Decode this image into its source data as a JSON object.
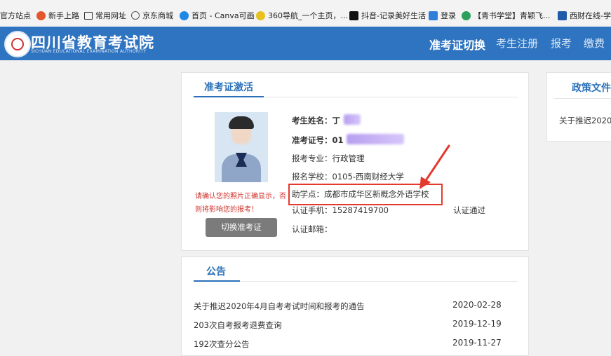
{
  "bookmarks": [
    {
      "label": "官方站点",
      "icon": "star-icon",
      "color": "#f2f2f2"
    },
    {
      "label": "新手上路",
      "icon": "firefox-icon",
      "color": "#e4572e"
    },
    {
      "label": "常用网址",
      "icon": "folder-icon",
      "color": "#f3f3f3"
    },
    {
      "label": "京东商城",
      "icon": "globe-icon",
      "color": "#555555"
    },
    {
      "label": "首页 - Canva可画",
      "icon": "canva-icon",
      "color": "#1e88e5"
    },
    {
      "label": "360导航_一个主页，...",
      "icon": "360-icon",
      "color": "#2e9a35"
    },
    {
      "label": "抖音-记录美好生活",
      "icon": "tiktok-icon",
      "color": "#111111"
    },
    {
      "label": "登录",
      "icon": "login-icon",
      "color": "#2f7fd8"
    },
    {
      "label": "【青书学堂】青颖飞...",
      "icon": "qingshu-icon",
      "color": "#2aa05a"
    },
    {
      "label": "西财在线-学业",
      "icon": "swufe-icon",
      "color": "#1f5ba8"
    }
  ],
  "header": {
    "title": "四川省教育考试院",
    "subtitle": "SICHUAN EDUCATIONAL EXAMINATION AUTHORITY",
    "nav": [
      "准考证切换",
      "考生注册",
      "报考",
      "缴费"
    ],
    "bg_color": "#2f74c0"
  },
  "activation": {
    "section_title": "准考证激活",
    "name_label": "考生姓名：",
    "name_value": "丁",
    "ticket_label": "准考证号：",
    "ticket_value": "01",
    "major_label": "报考专业：",
    "major_value": "行政管理",
    "school_label": "报名学校：",
    "school_value": "0105-西南财经大学",
    "center_label": "助学点：",
    "center_value": "成都市成华区新概念外语学校",
    "phone_label": "认证手机：",
    "phone_value": "15287419700",
    "phone_status": "认证通过",
    "email_label": "认证邮箱：",
    "email_value": "",
    "warning_line1": "请确认您的照片正确显示，否",
    "warning_line2": "则将影响您的报考！",
    "switch_button": "切换准考证",
    "highlight_color": "#e23b2e"
  },
  "policy": {
    "section_title": "政策文件",
    "items": [
      "关于推迟2020"
    ]
  },
  "notice": {
    "section_title": "公告",
    "items": [
      {
        "title": "关于推迟2020年4月自考考试时间和报考的通告",
        "date": "2020-02-28"
      },
      {
        "title": "203次自考报考退费查询",
        "date": "2019-12-19"
      },
      {
        "title": "192次查分公告",
        "date": "2019-11-27"
      }
    ]
  }
}
